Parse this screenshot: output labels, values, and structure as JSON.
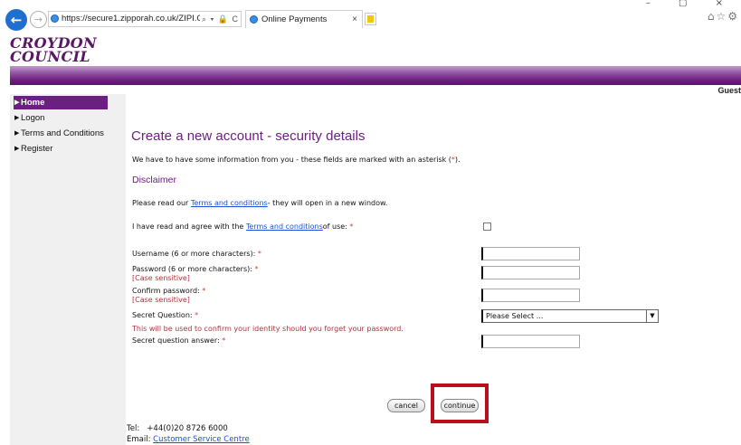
{
  "browser": {
    "url": "https://secure1.zipporah.co.uk/ZIPI.Croydon/",
    "address_tools": "⌕ ▾ 🔒 C",
    "tab_title": "Online Payments",
    "tab_close": "×",
    "window_controls": "–  ▢  ×",
    "toolbar_icons": [
      "home-icon",
      "star-icon",
      "gear-icon"
    ]
  },
  "site": {
    "logo_line1": "CROYDON",
    "logo_line2": "COUNCIL",
    "user_label": "Guest",
    "brand_color": "#6b1f80"
  },
  "sidebar": {
    "items": [
      {
        "label": "Home",
        "active": true
      },
      {
        "label": "Logon",
        "active": false
      },
      {
        "label": "Terms and Conditions",
        "active": false
      },
      {
        "label": "Register",
        "active": false
      }
    ]
  },
  "main": {
    "title": "Create a new account - security details",
    "intro_before": "We have to have some information from you - these fields are marked with an asterisk (",
    "intro_asterisk": "*",
    "intro_after": ").",
    "disclaimer_title": "Disclaimer",
    "disclaimer_before": "Please read our ",
    "disclaimer_link": "Terms and conditions",
    "disclaimer_after": "- they will open in a new window.",
    "agree_before": "I have read and agree with the ",
    "agree_link": "Terms and conditions",
    "agree_after": "of use: ",
    "agree_checked": false,
    "required_marker": "*",
    "fields": {
      "username_label": "Username (6 or more characters): ",
      "username_value": "",
      "password_label": "Password (6 or more characters): ",
      "password_hint": "[Case sensitive]",
      "password_value": "",
      "confirm_label": "Confirm password: ",
      "confirm_hint": "[Case sensitive]",
      "confirm_value": "",
      "question_label": "Secret Question: ",
      "question_selected": "Please Select ...",
      "question_hint": "This will be used to confirm your identity should you forget your password.",
      "answer_label": "Secret question answer: ",
      "answer_value": ""
    },
    "cancel_label": "cancel",
    "continue_label": "continue"
  },
  "footer": {
    "tel_label": "Tel:",
    "tel_value": "+44(0)20 8726 6000",
    "email_label": "Email:",
    "email_link": "Customer Service Centre"
  }
}
